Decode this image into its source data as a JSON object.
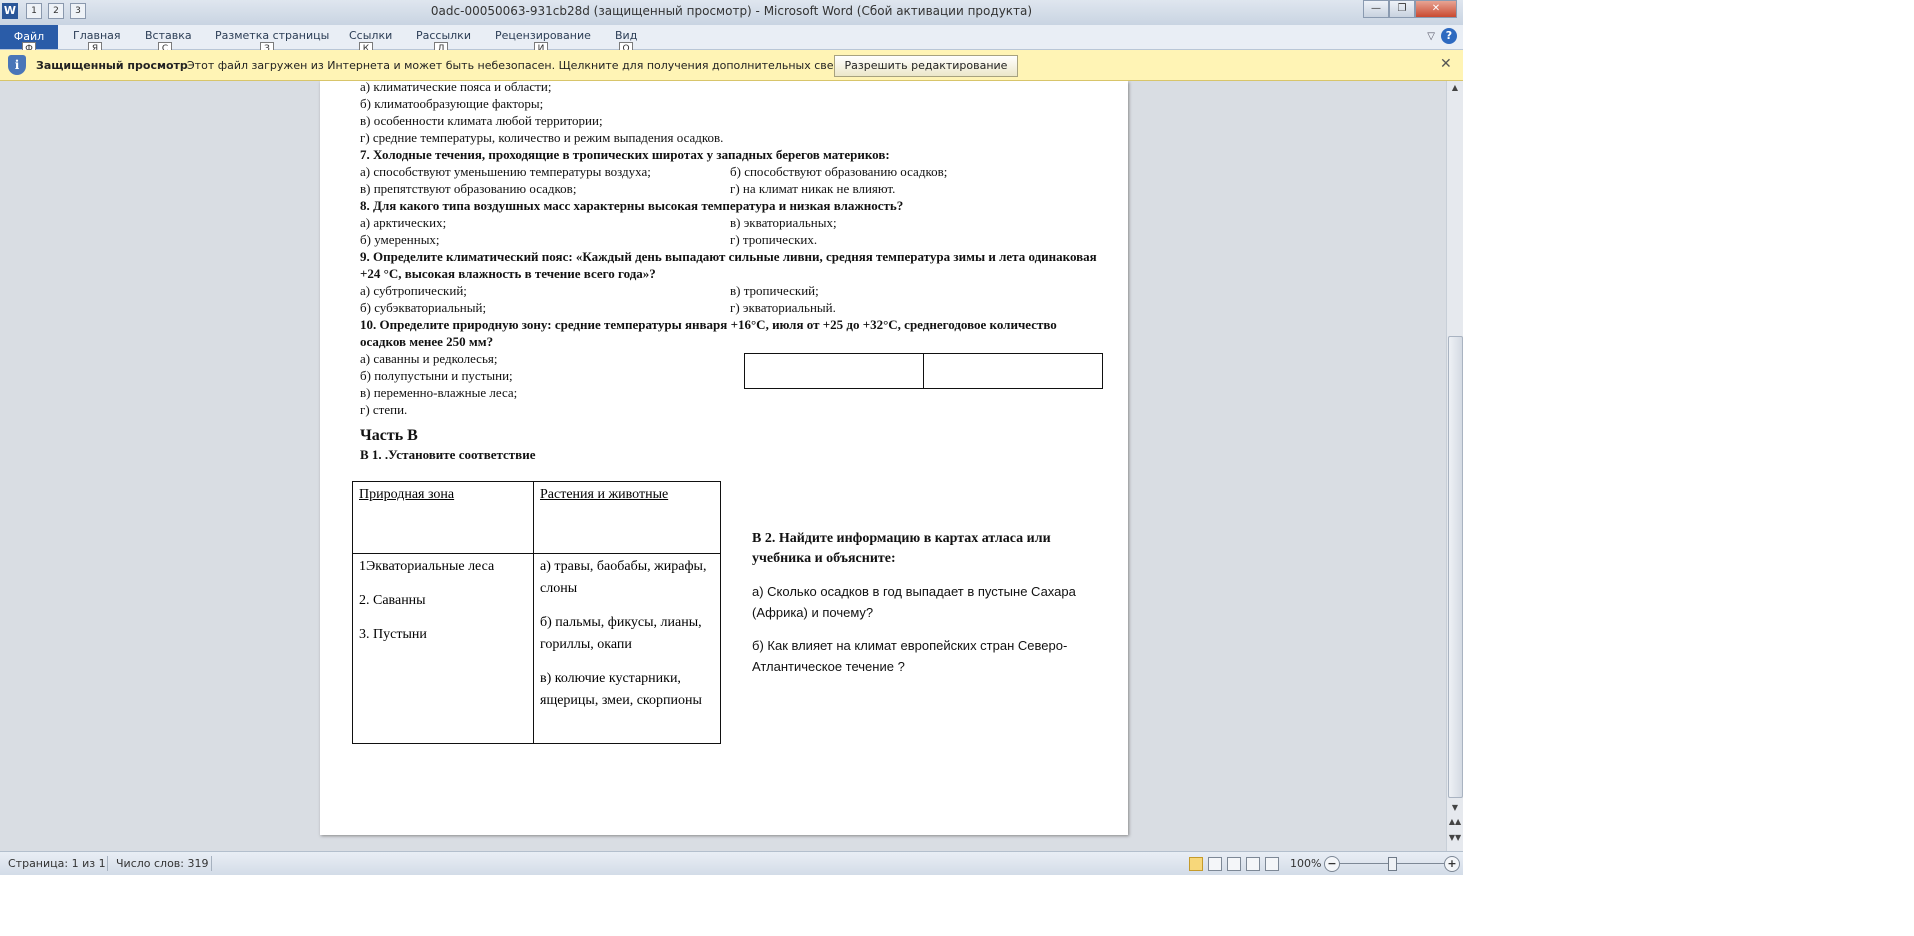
{
  "titlebar": {
    "app_icon": "W",
    "title": "0adc-00050063-931cb28d (защищенный просмотр)  -  Microsoft Word (Сбой активации продукта)",
    "qat_keytips": [
      "1",
      "2",
      "3"
    ],
    "minimize": "—",
    "maximize": "❐",
    "close": "✕"
  },
  "ribbon": {
    "tabs": [
      {
        "label": "Файл",
        "keytip": "Ф"
      },
      {
        "label": "Главная",
        "keytip": "Я"
      },
      {
        "label": "Вставка",
        "keytip": "С"
      },
      {
        "label": "Разметка страницы",
        "keytip": "З"
      },
      {
        "label": "Ссылки",
        "keytip": "К"
      },
      {
        "label": "Рассылки",
        "keytip": "Л"
      },
      {
        "label": "Рецензирование",
        "keytip": "И"
      },
      {
        "label": "Вид",
        "keytip": "О"
      }
    ],
    "help": "?",
    "collapse": "▽"
  },
  "message_bar": {
    "title": "Защищенный просмотр",
    "text": "Этот файл загружен из Интернета и может быть небезопасен. Щелкните для получения дополнительных сведений.",
    "button": "Разрешить редактирование",
    "close": "✕"
  },
  "document": {
    "partA": {
      "pre_lines": [
        "а) климатические пояса и области;",
        "б) климатообразующие факторы;",
        "в) особенности климата любой территории;",
        "г) средние температуры, количество и режим выпадения осадков."
      ],
      "q7": {
        "question": "7. Холодные течения, проходящие в тропических широтах у западных берегов материков:",
        "rows": [
          [
            "а) способствуют уменьшению температуры воздуха;",
            "б) способствуют образованию осадков;"
          ],
          [
            "в) препятствуют образованию осадков;",
            "г) на климат никак не влияют."
          ]
        ]
      },
      "q8": {
        "question": "8. Для какого типа воздушных масс характерны высокая температура и низкая влажность?",
        "rows": [
          [
            "а) арктических;",
            "в) экваториальных;"
          ],
          [
            "б) умеренных;",
            "г) тропических."
          ]
        ]
      },
      "q9": {
        "question": "9. Определите климатический пояс: «Каждый день выпадают сильные ливни, средняя температура зимы и лета одинаковая +24 °С, высокая влажность в течение всего года»?",
        "rows": [
          [
            "а) субтропический;",
            "в) тропический;"
          ],
          [
            "б) субэкваториальный;",
            "г) экваториальный."
          ]
        ]
      },
      "q10": {
        "question": "10. Определите природную зону: средние температуры января +16°С, июля от +25 до +32°С, среднегодовое количество осадков менее 250 мм?",
        "options": [
          "а) саванны и редколесья;",
          "б) полупустыни  и пустыни;",
          "в) переменно-влажные леса;",
          "г) степи."
        ]
      }
    },
    "partB": {
      "heading": "Часть В",
      "b1": {
        "title": "В 1. .Установите соответствие",
        "col1_header": "Природная зона",
        "col2_header": "Растения и животные",
        "zones": [
          "1Экваториальные леса",
          "2. Саванны",
          "3. Пустыни"
        ],
        "fauna": [
          "а)   травы, баобабы, жирафы, слоны",
          "б) пальмы, фикусы, лианы, гориллы, окапи",
          "в) колючие кустарники, ящерицы, змеи, скорпионы"
        ]
      },
      "b2": {
        "title": "В 2. Найдите информацию в картах атласа или учебника и объясните:",
        "items": [
          "а)  Сколько осадков в год выпадает в пустыне Сахара (Африка) и почему?",
          "б) Как влияет на климат европейских стран Северо-Атлантическое течение ?"
        ]
      }
    }
  },
  "statusbar": {
    "page": "Страница: 1 из 1",
    "words": "Число слов: 319",
    "zoom": "100%",
    "zoom_minus": "−",
    "zoom_plus": "+"
  },
  "scrollbar": {
    "up": "▲",
    "down": "▼",
    "prev": "▲▲",
    "next": "▼▼"
  }
}
